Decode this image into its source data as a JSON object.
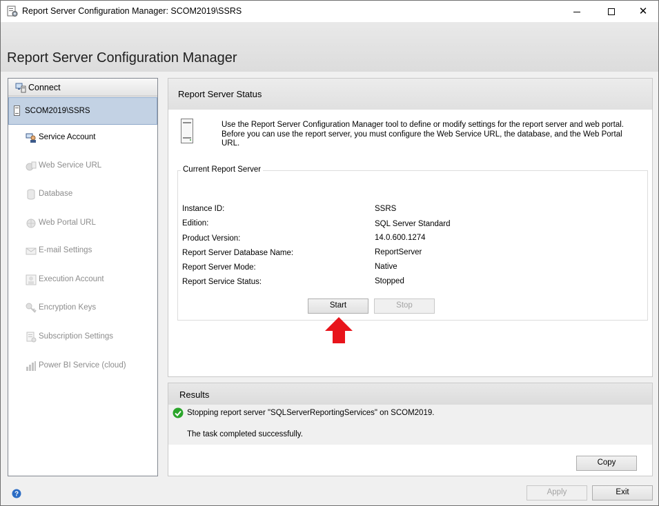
{
  "window": {
    "title": "Report Server Configuration Manager: SCOM2019\\SSRS",
    "app_icon": "report-server-config-icon",
    "controls": {
      "minimize": "minimize-icon",
      "maximize": "maximize-icon",
      "close": "✕"
    }
  },
  "header": {
    "title": "Report Server Configuration Manager"
  },
  "sidebar": {
    "connect_label": "Connect",
    "server_node": "SCOM2019\\SSRS",
    "items": [
      {
        "label": "Service Account",
        "icon": "service-account-icon",
        "enabled": true
      },
      {
        "label": "Web Service URL",
        "icon": "web-service-url-icon",
        "enabled": false
      },
      {
        "label": "Database",
        "icon": "database-icon",
        "enabled": false
      },
      {
        "label": "Web Portal URL",
        "icon": "web-portal-url-icon",
        "enabled": false
      },
      {
        "label": "E-mail Settings",
        "icon": "email-settings-icon",
        "enabled": false
      },
      {
        "label": "Execution Account",
        "icon": "execution-account-icon",
        "enabled": false
      },
      {
        "label": "Encryption Keys",
        "icon": "encryption-keys-icon",
        "enabled": false
      },
      {
        "label": "Subscription Settings",
        "icon": "subscription-settings-icon",
        "enabled": false
      },
      {
        "label": "Power BI Service (cloud)",
        "icon": "power-bi-icon",
        "enabled": false
      }
    ]
  },
  "status": {
    "title": "Report Server Status",
    "intro": "Use the Report Server Configuration Manager tool to define or modify settings for the report server and web portal. Before you can use the report server, you must configure the Web Service URL, the database, and the Web Portal URL.",
    "group_title": "Current Report Server",
    "rows": [
      {
        "label": "Instance ID:",
        "value": "SSRS"
      },
      {
        "label": "Edition:",
        "value": "SQL Server Standard"
      },
      {
        "label": "Product Version:",
        "value": "14.0.600.1274"
      },
      {
        "label": "Report Server Database Name:",
        "value": "ReportServer"
      },
      {
        "label": "Report Server Mode:",
        "value": "Native"
      },
      {
        "label": "Report Service Status:",
        "value": "Stopped"
      }
    ],
    "start_label": "Start",
    "stop_label": "Stop"
  },
  "results": {
    "title": "Results",
    "line1": "Stopping report server \"SQLServerReportingServices\" on SCOM2019.",
    "line2": "The task completed successfully.",
    "copy_label": "Copy"
  },
  "footer": {
    "apply_label": "Apply",
    "exit_label": "Exit"
  },
  "colors": {
    "accent_selection": "#c3d2e4",
    "arrow": "#e8141b",
    "success": "#2aa52a"
  }
}
